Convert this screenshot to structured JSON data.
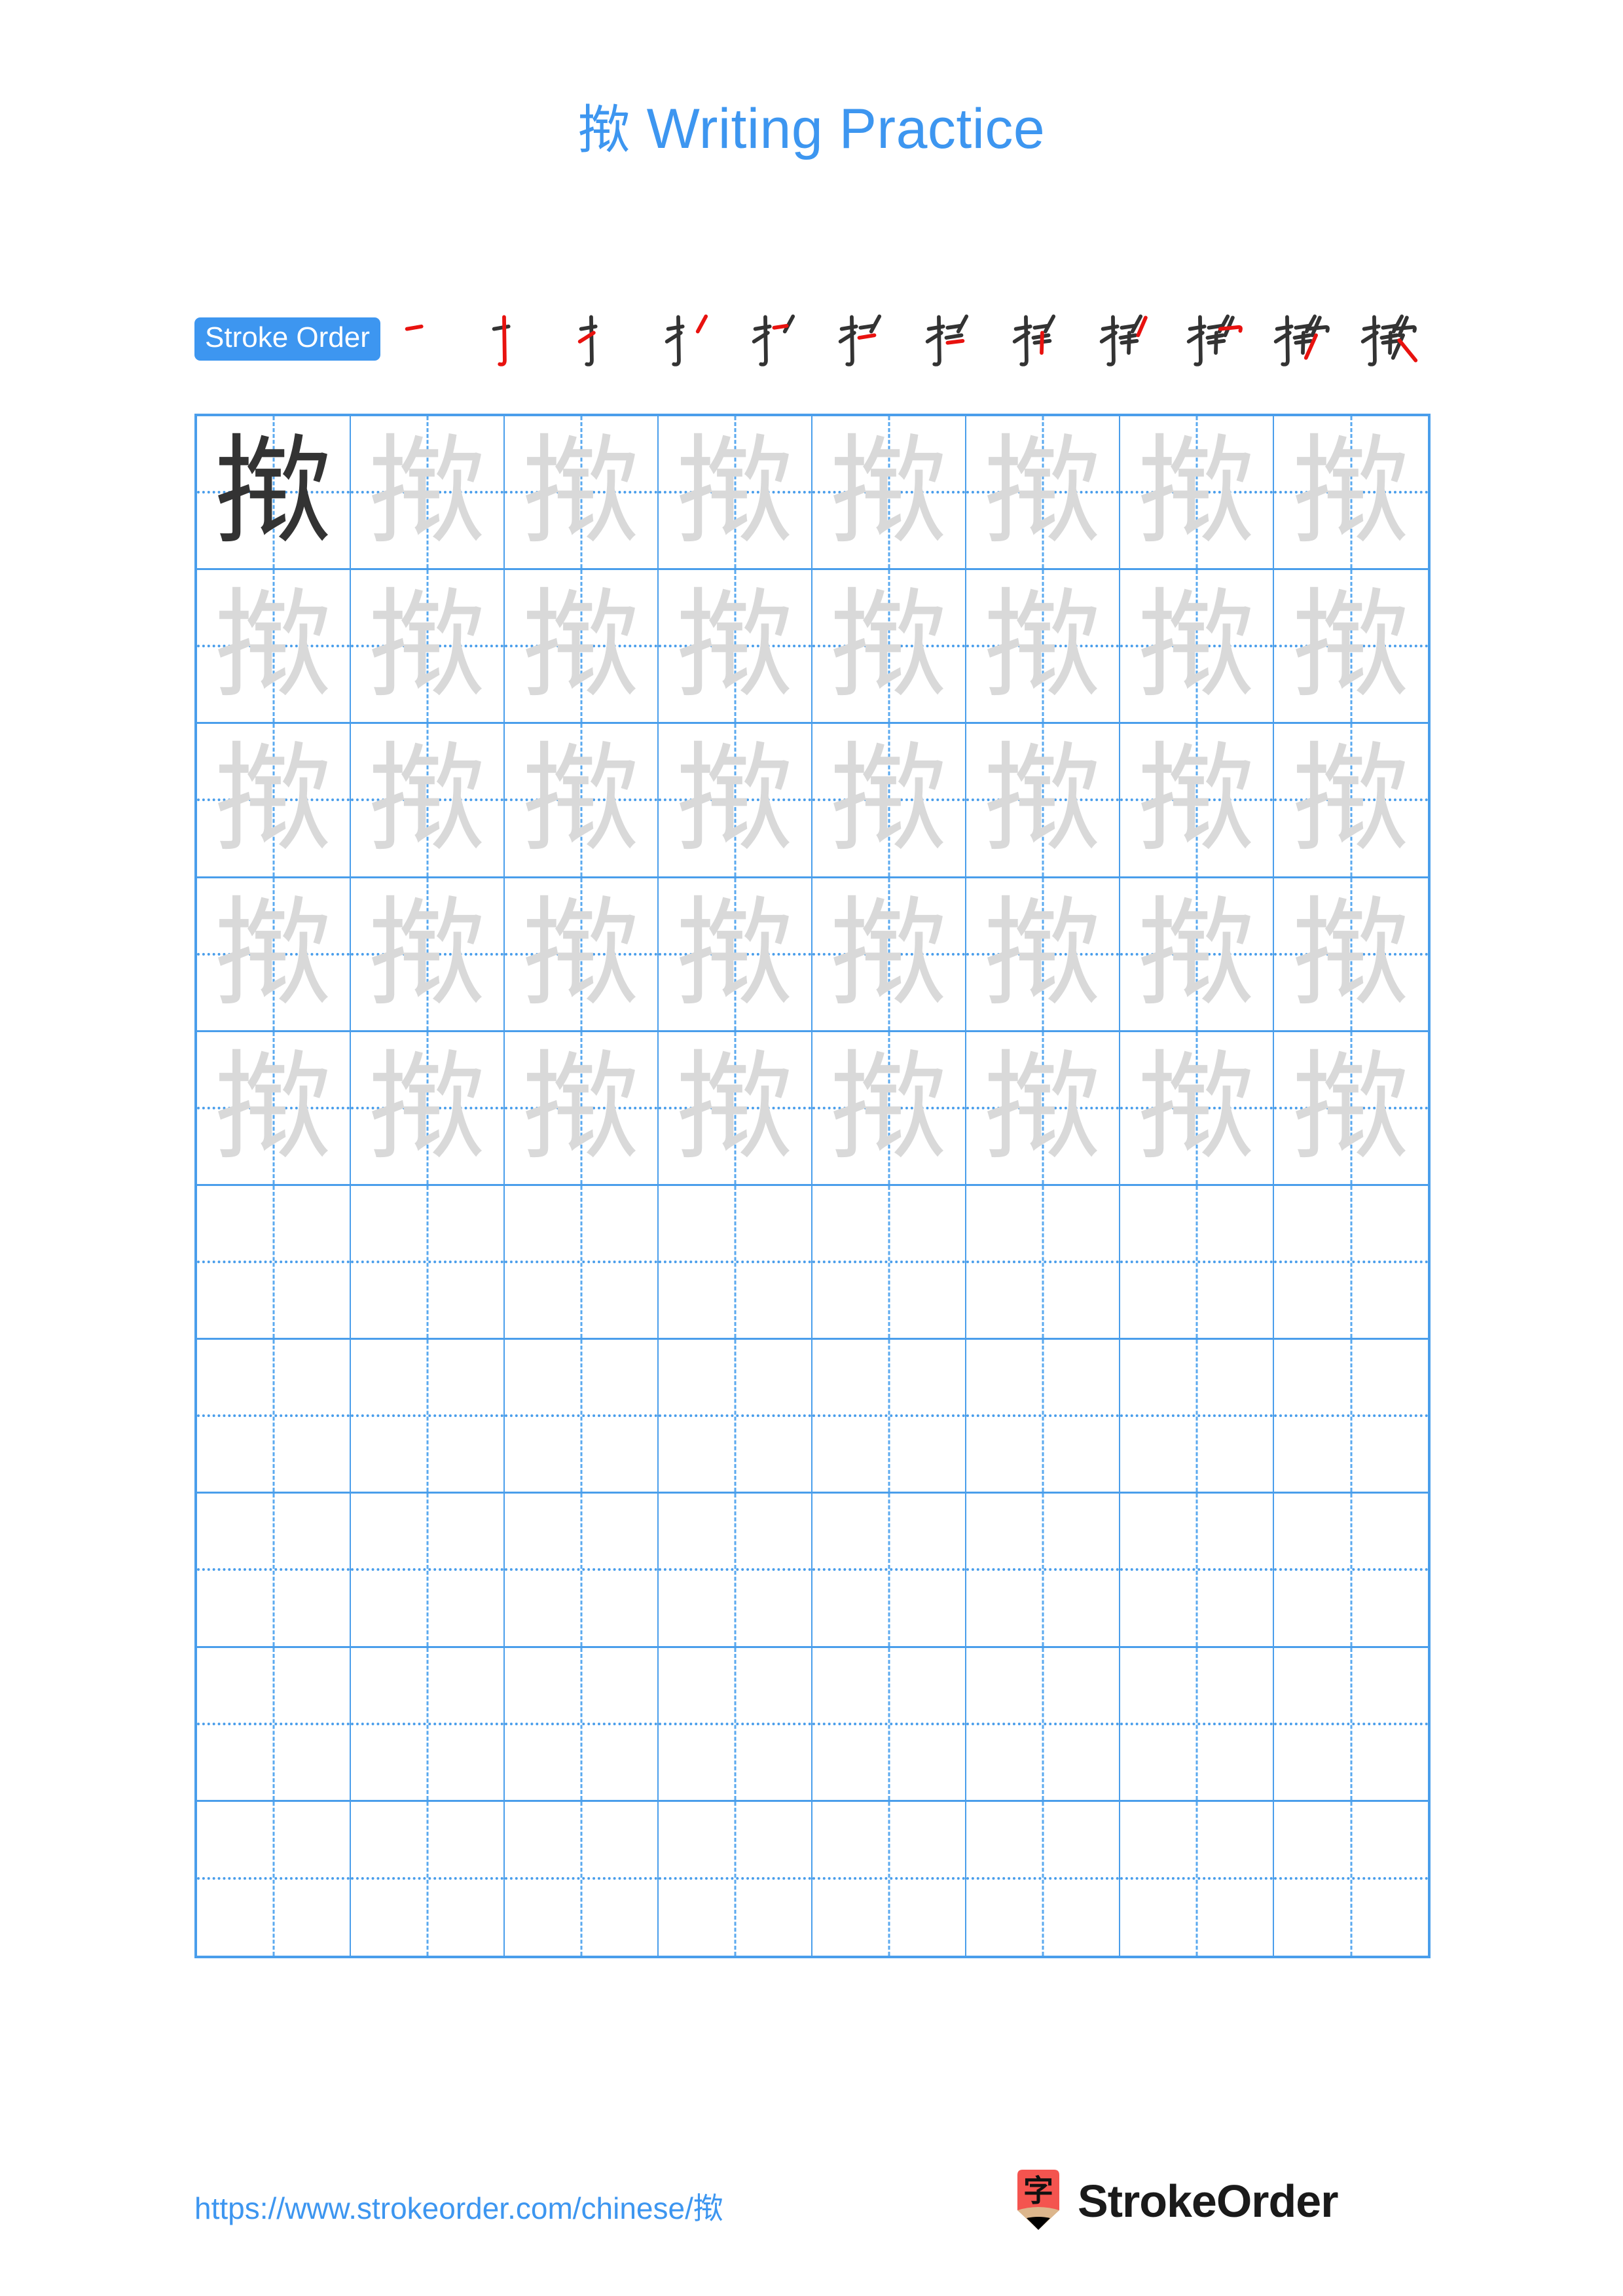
{
  "page": {
    "background_color": "#ffffff",
    "accent_color": "#3d96f0",
    "grid_line_color": "#4a9eeb",
    "trace_glyph_color": "#d9d9d9",
    "model_glyph_color": "#333333",
    "highlight_stroke_color": "#e8120f"
  },
  "header": {
    "character": "揿",
    "title_suffix": " Writing Practice",
    "full_title": "揿 Writing Practice"
  },
  "stroke_order": {
    "badge_label": "Stroke Order",
    "total_strokes": 12,
    "steps": [
      {
        "index": 1,
        "partial": "一",
        "new_stroke": "héng (horizontal)"
      },
      {
        "index": 2,
        "partial": "十",
        "new_stroke": "shù-gōu (vertical hook)"
      },
      {
        "index": 3,
        "partial": "扌",
        "new_stroke": "tí (rising)"
      },
      {
        "index": 4,
        "partial": "扌丿",
        "new_stroke": "piě (left-falling)"
      },
      {
        "index": 5,
        "partial": "扩",
        "new_stroke": "héng (horizontal)"
      },
      {
        "index": 6,
        "partial": "扩",
        "new_stroke": "héng (horizontal)"
      },
      {
        "index": 7,
        "partial": "扝",
        "new_stroke": "héng (horizontal)"
      },
      {
        "index": 8,
        "partial": "扝",
        "new_stroke": "shù (vertical)"
      },
      {
        "index": 9,
        "partial": "揿",
        "new_stroke": "piě (left-falling)"
      },
      {
        "index": 10,
        "partial": "揿",
        "new_stroke": "héng-gōu (horizontal hook)"
      },
      {
        "index": 11,
        "partial": "揿",
        "new_stroke": "piě (left-falling)"
      },
      {
        "index": 12,
        "partial": "揿",
        "new_stroke": "nà (right-falling)"
      }
    ]
  },
  "practice_grid": {
    "columns": 8,
    "rows": 10,
    "cell_character": "揿",
    "rows_data": [
      [
        "model",
        "trace",
        "trace",
        "trace",
        "trace",
        "trace",
        "trace",
        "trace"
      ],
      [
        "trace",
        "trace",
        "trace",
        "trace",
        "trace",
        "trace",
        "trace",
        "trace"
      ],
      [
        "trace",
        "trace",
        "trace",
        "trace",
        "trace",
        "trace",
        "trace",
        "trace"
      ],
      [
        "trace",
        "trace",
        "trace",
        "trace",
        "trace",
        "trace",
        "trace",
        "trace"
      ],
      [
        "trace",
        "trace",
        "trace",
        "trace",
        "trace",
        "trace",
        "trace",
        "trace"
      ],
      [
        "empty",
        "empty",
        "empty",
        "empty",
        "empty",
        "empty",
        "empty",
        "empty"
      ],
      [
        "empty",
        "empty",
        "empty",
        "empty",
        "empty",
        "empty",
        "empty",
        "empty"
      ],
      [
        "empty",
        "empty",
        "empty",
        "empty",
        "empty",
        "empty",
        "empty",
        "empty"
      ],
      [
        "empty",
        "empty",
        "empty",
        "empty",
        "empty",
        "empty",
        "empty",
        "empty"
      ],
      [
        "empty",
        "empty",
        "empty",
        "empty",
        "empty",
        "empty",
        "empty",
        "empty"
      ]
    ]
  },
  "footer": {
    "url_prefix": "https://www.strokeorder.com/chinese/",
    "url_character": "揿",
    "url_full": "https://www.strokeorder.com/chinese/揿",
    "brand_name": "StrokeOrder",
    "logo_character": "字",
    "logo_body_color": "#f4544f",
    "logo_wood_color": "#dcb68c",
    "logo_tip_color": "#000000"
  }
}
